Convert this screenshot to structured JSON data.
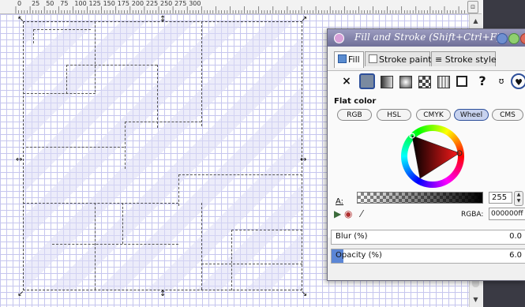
{
  "ruler": {
    "labels": [
      "0",
      "25",
      "50",
      "75",
      "100",
      "125",
      "150",
      "175",
      "200",
      "225",
      "250",
      "275",
      "300"
    ]
  },
  "dialog": {
    "title": "Fill and Stroke (Shift+Ctrl+F)",
    "tabs": [
      {
        "label": "Fill"
      },
      {
        "label": "Stroke paint"
      },
      {
        "label": "Stroke style"
      }
    ],
    "paint_buttons": [
      "no-paint",
      "flat-color",
      "linear-gradient",
      "radial-gradient",
      "pattern",
      "swatch",
      "unset",
      "unknown",
      "fill-rule-evenodd",
      "fill-rule-nonzero"
    ],
    "no_paint_glyph": "×",
    "unset_glyph": "?",
    "section_title": "Flat color",
    "color_modes": [
      "RGB",
      "HSL",
      "CMYK",
      "Wheel",
      "CMS"
    ],
    "active_mode": "Wheel",
    "alpha_label": "A:",
    "alpha_value": "255",
    "rgba_label": "RGBA:",
    "rgba_value": "000000ff",
    "blur_label": "Blur (%)",
    "blur_value": "0.0",
    "opacity_label": "Opacity (%)",
    "opacity_value": "6.0"
  },
  "colors": {
    "titlebar": "#7f7faa",
    "active_mode": "#c7d2ee",
    "grid": "#c6c6ee",
    "slider_fill": "#5b86d6"
  }
}
